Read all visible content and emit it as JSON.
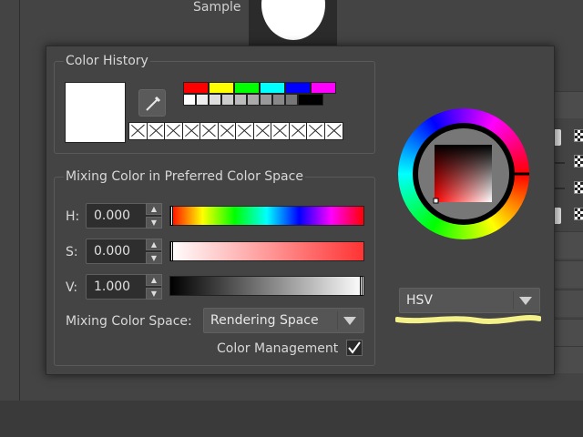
{
  "sample": {
    "label": "Sample"
  },
  "history": {
    "title": "Color History",
    "palette_row1": [
      "#ff0000",
      "#ffff00",
      "#00ff00",
      "#00ffff",
      "#0000ff",
      "#ff00ff"
    ],
    "palette_row2": [
      "#ffffff",
      "#eeeeee",
      "#dddddd",
      "#cccccc",
      "#bbbbbb",
      "#aaaaaa",
      "#999999",
      "#888888",
      "#777777",
      "#000000"
    ],
    "empty_slots": 12,
    "current_color": "#ffffff"
  },
  "mixing": {
    "title": "Mixing Color in Preferred Color Space",
    "channels": [
      {
        "label": "H:",
        "value": "0.000"
      },
      {
        "label": "S:",
        "value": "0.000"
      },
      {
        "label": "V:",
        "value": "1.000"
      }
    ],
    "color_space_label": "Mixing Color Space:",
    "color_space_value": "Rendering Space",
    "color_management_label": "Color Management",
    "color_management_checked": true
  },
  "wheel": {
    "mode": "HSV"
  },
  "highlight_color": "#f4f08a"
}
